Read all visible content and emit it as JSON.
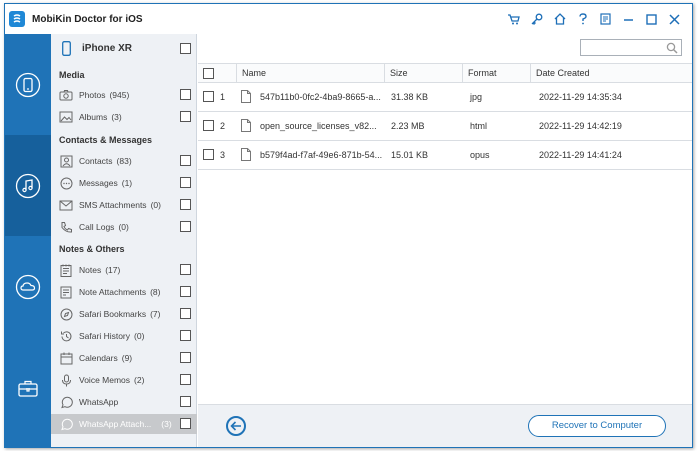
{
  "app": {
    "title": "MobiKin Doctor for iOS"
  },
  "titlebar_icons": [
    "cart-icon",
    "key-icon",
    "home-icon",
    "help-icon",
    "feedback-icon",
    "minimize-icon",
    "maximize-icon",
    "close-icon"
  ],
  "strip": {
    "items": [
      {
        "name": "device-recovery",
        "icon": "phone-icon",
        "active": false
      },
      {
        "name": "itunes-recovery",
        "icon": "music-device-icon",
        "active": true
      },
      {
        "name": "icloud-recovery",
        "icon": "cloud-icon",
        "active": false
      },
      {
        "name": "toolbox",
        "icon": "toolbox-icon",
        "active": false
      }
    ]
  },
  "device": {
    "name": "iPhone XR"
  },
  "sections": {
    "media": "Media",
    "contacts": "Contacts & Messages",
    "notes": "Notes & Others"
  },
  "categories": [
    {
      "label": "Photos",
      "count": "(945)",
      "icon": "camera-icon"
    },
    {
      "label": "Albums",
      "count": "(3)",
      "icon": "image-icon"
    },
    {
      "label": "Contacts",
      "count": "(83)",
      "icon": "contact-card-icon"
    },
    {
      "label": "Messages",
      "count": "(1)",
      "icon": "chat-bubble-icon"
    },
    {
      "label": "SMS Attachments",
      "count": "(0)",
      "icon": "envelope-icon"
    },
    {
      "label": "Call Logs",
      "count": "(0)",
      "icon": "phone-handset-icon"
    },
    {
      "label": "Notes",
      "count": "(17)",
      "icon": "notepad-icon"
    },
    {
      "label": "Note Attachments",
      "count": "(8)",
      "icon": "note-attachment-icon"
    },
    {
      "label": "Safari Bookmarks",
      "count": "(7)",
      "icon": "compass-icon"
    },
    {
      "label": "Safari History",
      "count": "(0)",
      "icon": "history-icon"
    },
    {
      "label": "Calendars",
      "count": "(9)",
      "icon": "calendar-icon"
    },
    {
      "label": "Voice Memos",
      "count": "(2)",
      "icon": "microphone-icon"
    },
    {
      "label": "WhatsApp",
      "count": "",
      "icon": "whatsapp-icon"
    },
    {
      "label": "WhatsApp Attach...",
      "count": "(3)",
      "icon": "whatsapp-attachment-icon"
    }
  ],
  "search": {
    "placeholder": ""
  },
  "table": {
    "headers": {
      "name": "Name",
      "size": "Size",
      "format": "Format",
      "date": "Date Created"
    },
    "rows": [
      {
        "index": "1",
        "name": "547b11b0-0fc2-4ba9-8665-a...",
        "size": "31.38 KB",
        "format": "jpg",
        "date": "2022-11-29 14:35:34"
      },
      {
        "index": "2",
        "name": "open_source_licenses_v82...",
        "size": "2.23 MB",
        "format": "html",
        "date": "2022-11-29 14:42:19"
      },
      {
        "index": "3",
        "name": "b579f4ad-f7af-49e6-871b-54...",
        "size": "15.01 KB",
        "format": "opus",
        "date": "2022-11-29 14:41:24"
      }
    ]
  },
  "footer": {
    "recover_label": "Recover to Computer"
  },
  "colors": {
    "accent": "#1f73b7",
    "accent_dark": "#16609c",
    "panel_bg": "#eef1f5"
  }
}
